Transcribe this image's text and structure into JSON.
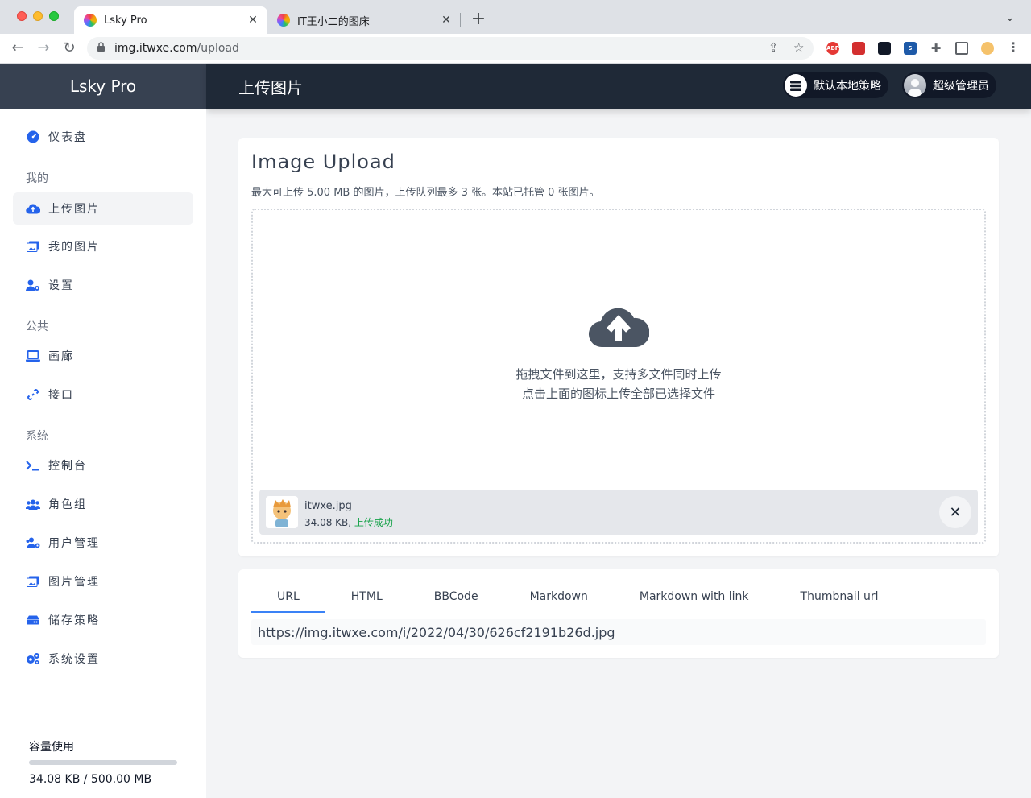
{
  "browser": {
    "tabs": [
      {
        "title": "Lsky Pro",
        "active": true
      },
      {
        "title": "IT王小二的图床",
        "active": false
      }
    ],
    "url_host": "img.itwxe.com",
    "url_path": "/upload"
  },
  "header": {
    "brand": "Lsky Pro",
    "page_title": "上传图片",
    "strategy_label": "默认本地策略",
    "user_label": "超级管理员"
  },
  "sidebar": {
    "dashboard": "仪表盘",
    "section_mine": "我的",
    "upload": "上传图片",
    "my_images": "我的图片",
    "settings": "设置",
    "section_public": "公共",
    "gallery": "画廊",
    "api": "接口",
    "section_system": "系统",
    "console": "控制台",
    "roles": "角色组",
    "user_mgmt": "用户管理",
    "image_mgmt": "图片管理",
    "storage": "储存策略",
    "system_settings": "系统设置",
    "capacity_label": "容量使用",
    "capacity_text": "34.08 KB / 500.00 MB",
    "capacity_fraction": 6.65e-05
  },
  "upload": {
    "title": "Image Upload",
    "subtitle": "最大可上传 5.00 MB 的图片，上传队列最多 3 张。本站已托管 0 张图片。",
    "drop_line1": "拖拽文件到这里，支持多文件同时上传",
    "drop_line2": "点击上面的图标上传全部已选择文件",
    "file": {
      "name": "itwxe.jpg",
      "size": "34.08 KB,",
      "status": "上传成功"
    }
  },
  "links": {
    "tabs": [
      "URL",
      "HTML",
      "BBCode",
      "Markdown",
      "Markdown with link",
      "Thumbnail url"
    ],
    "active_tab": "URL",
    "value": "https://img.itwxe.com/i/2022/04/30/626cf2191b26d.jpg"
  },
  "colors": {
    "header": "#1f2937",
    "brand_bg": "#374151",
    "accent": "#3b82f6",
    "success": "#16a34a"
  }
}
